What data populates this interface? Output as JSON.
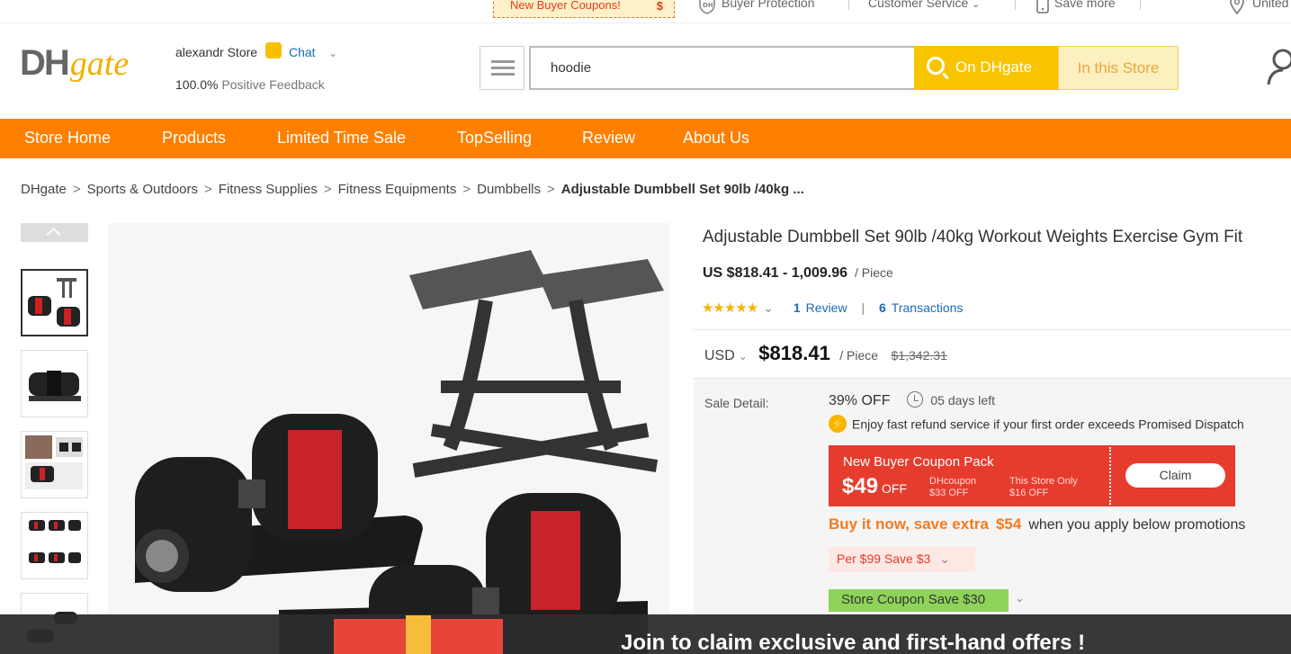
{
  "topbar": {
    "coupon_label": "New Buyer Coupons!",
    "coupon_symbol": "$",
    "buyer_protection": "Buyer Protection",
    "customer_service": "Customer Service",
    "save_more": "Save more",
    "region": "United"
  },
  "header": {
    "logo_dh": "DH",
    "logo_gate": "gate",
    "store_name": "alexandr Store",
    "chat_label": "Chat",
    "feedback_value": "100.0%",
    "feedback_label": "Positive Feedback",
    "search_value": "hoodie",
    "btn_on_dhgate": "On DHgate",
    "btn_in_store": "In this Store"
  },
  "nav": {
    "items": [
      "Store Home",
      "Products",
      "Limited Time Sale",
      "TopSelling",
      "Review",
      "About Us"
    ]
  },
  "breadcrumb": {
    "items": [
      "DHgate",
      "Sports & Outdoors",
      "Fitness Supplies",
      "Fitness Equipments",
      "Dumbbells"
    ],
    "current": "Adjustable Dumbbell Set 90lb /40kg ..."
  },
  "product": {
    "title": "Adjustable Dumbbell Set 90lb /40kg Workout Weights Exercise Gym Fit",
    "price_range": "US $818.41 - 1,009.96",
    "unit": "/ Piece",
    "stars": "★★★★★",
    "review_count": "1",
    "review_label": "Review",
    "transaction_count": "6",
    "transaction_label": "Transactions",
    "currency": "USD",
    "price": "$818.41",
    "price_unit": "/ Piece",
    "original_price": "$1,342.31"
  },
  "sale": {
    "label": "Sale Detail:",
    "discount": "39% OFF",
    "time_left": "05 days left",
    "refund_text": "Enjoy fast refund service if your first order exceeds Promised Dispatch",
    "coupon_pack_title": "New Buyer Coupon Pack",
    "coupon_pack_amount": "$49",
    "coupon_pack_off": "OFF",
    "dhcoupon_label": "DHcoupon",
    "dhcoupon_value": "$33 OFF",
    "store_only_label": "This Store Only",
    "store_only_value": "$16 OFF",
    "claim_label": "Claim",
    "buynow_lead": "Buy it now, save extra",
    "buynow_amount": "$54",
    "buynow_rest": "when you apply below promotions",
    "per99_text": "Per  $99  Save  $3",
    "store_coupon_text": "Store Coupon Save $30"
  },
  "promo": {
    "text": "Join to claim exclusive and first-hand offers !"
  },
  "colors": {
    "nav_orange": "#ff7f00",
    "search_yellow": "#f8c400",
    "coupon_red": "#e63c2e",
    "link_blue": "#1a6bb8",
    "store_coupon_green": "#8ed35a"
  }
}
